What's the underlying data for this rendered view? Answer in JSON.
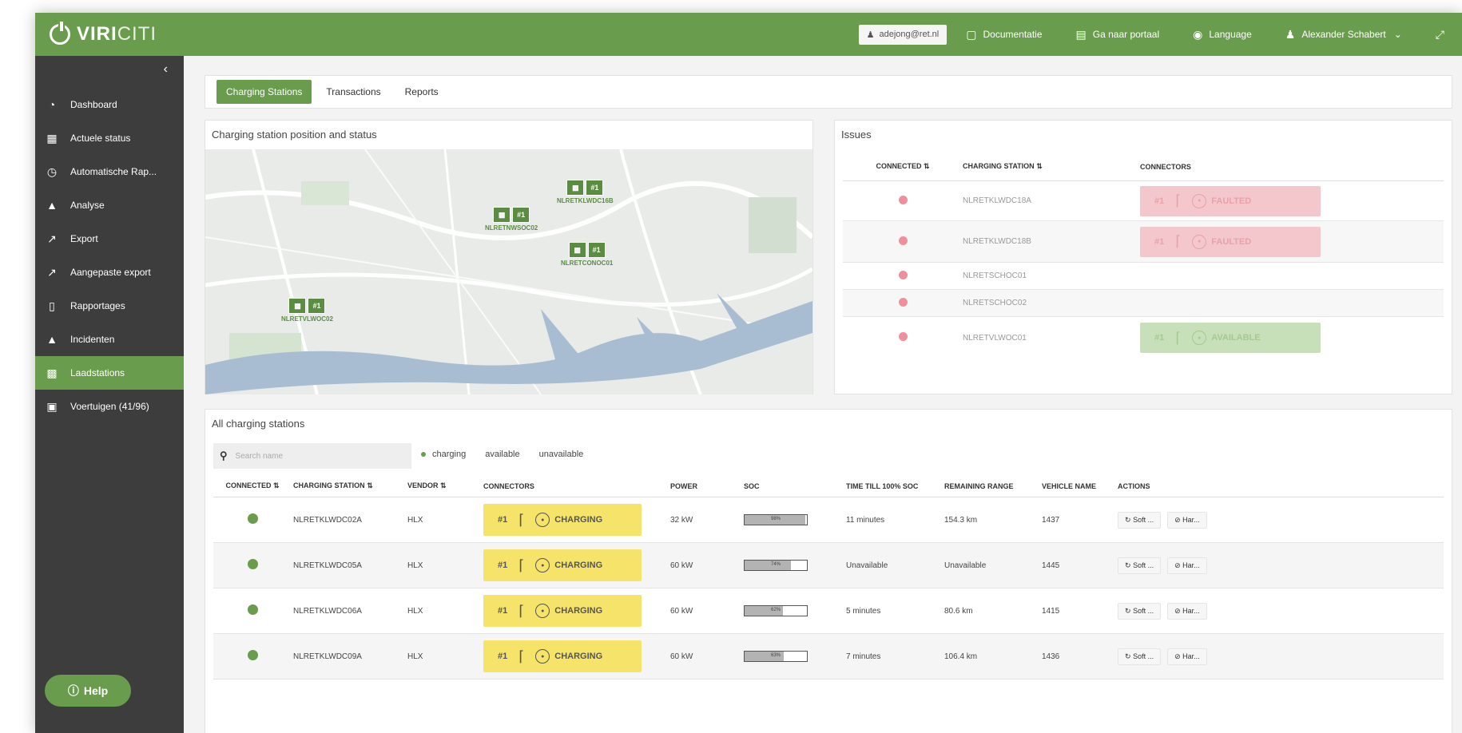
{
  "brand": {
    "name_bold": "VIRI",
    "name_thin": "CITI"
  },
  "topbar": {
    "user_chip": "adejong@ret.nl",
    "documentation": "Documentatie",
    "portal": "Ga naar portaal",
    "language": "Language",
    "user_name": "Alexander Schabert"
  },
  "sidebar": {
    "items": [
      {
        "label": "Dashboard",
        "icon": "gauge-icon"
      },
      {
        "label": "Actuele status",
        "icon": "map-icon"
      },
      {
        "label": "Automatische Rap...",
        "icon": "clock-icon"
      },
      {
        "label": "Analyse",
        "icon": "area-chart-icon"
      },
      {
        "label": "Export",
        "icon": "export-icon"
      },
      {
        "label": "Aangepaste export",
        "icon": "export-icon"
      },
      {
        "label": "Rapportages",
        "icon": "document-icon"
      },
      {
        "label": "Incidenten",
        "icon": "warning-icon"
      },
      {
        "label": "Laadstations",
        "icon": "charging-station-icon"
      },
      {
        "label": "Voertuigen (41/96)",
        "icon": "bus-icon"
      }
    ],
    "active_index": 8,
    "help_label": "Help"
  },
  "tabs": [
    "Charging Stations",
    "Transactions",
    "Reports"
  ],
  "map_card": {
    "title": "Charging station position and status",
    "markers": [
      {
        "name": "NLRETKLWDC16B",
        "num": "#1"
      },
      {
        "name": "NLRETNWSOC02",
        "num": "#1"
      },
      {
        "name": "NLRETCONOC01",
        "num": "#1"
      },
      {
        "name": "NLRETVLWOC02",
        "num": "#1"
      }
    ]
  },
  "issues": {
    "title": "Issues",
    "headers": [
      "CONNECTED",
      "CHARGING STATION",
      "CONNECTORS"
    ],
    "rows": [
      {
        "station": "NLRETKLWDC18A",
        "connector_num": "#1",
        "status": "FAULTED"
      },
      {
        "station": "NLRETKLWDC18B",
        "connector_num": "#1",
        "status": "FAULTED"
      },
      {
        "station": "NLRETSCHOC01",
        "connector_num": "",
        "status": ""
      },
      {
        "station": "NLRETSCHOC02",
        "connector_num": "",
        "status": ""
      },
      {
        "station": "NLRETVLWOC01",
        "connector_num": "#1",
        "status": "AVAILABLE"
      }
    ]
  },
  "all_stations": {
    "title": "All charging stations",
    "search_placeholder": "Search name",
    "filters": [
      "charging",
      "available",
      "unavailable"
    ],
    "headers": [
      "CONNECTED",
      "CHARGING STATION",
      "VENDOR",
      "CONNECTORS",
      "POWER",
      "SOC",
      "TIME TILL 100% SOC",
      "REMAINING RANGE",
      "VEHICLE NAME",
      "ACTIONS"
    ],
    "rows": [
      {
        "station": "NLRETKLWDC02A",
        "vendor": "HLX",
        "connector_num": "#1",
        "status": "CHARGING",
        "power": "32 kW",
        "soc": 0.98,
        "soc_label": "98%",
        "time": "11 minutes",
        "range": "154.3 km",
        "vehicle": "1437",
        "soft": "Soft ...",
        "hard": "Har..."
      },
      {
        "station": "NLRETKLWDC05A",
        "vendor": "HLX",
        "connector_num": "#1",
        "status": "CHARGING",
        "power": "60 kW",
        "soc": 0.74,
        "soc_label": "74%",
        "time": "Unavailable",
        "range": "Unavailable",
        "vehicle": "1445",
        "soft": "Soft ...",
        "hard": "Har..."
      },
      {
        "station": "NLRETKLWDC06A",
        "vendor": "HLX",
        "connector_num": "#1",
        "status": "CHARGING",
        "power": "60 kW",
        "soc": 0.62,
        "soc_label": "62%",
        "time": "5 minutes",
        "range": "80.6 km",
        "vehicle": "1415",
        "soft": "Soft ...",
        "hard": "Har..."
      },
      {
        "station": "NLRETKLWDC09A",
        "vendor": "HLX",
        "connector_num": "#1",
        "status": "CHARGING",
        "power": "60 kW",
        "soc": 0.63,
        "soc_label": "63%",
        "time": "7 minutes",
        "range": "106.4 km",
        "vehicle": "1436",
        "soft": "Soft ...",
        "hard": "Har..."
      }
    ]
  },
  "colors": {
    "brand_green": "#6a9c4e",
    "sidebar_dark": "#3d3d3d",
    "charging_yellow": "#f6e36a",
    "faulted_pink": "#f3c7cc"
  }
}
